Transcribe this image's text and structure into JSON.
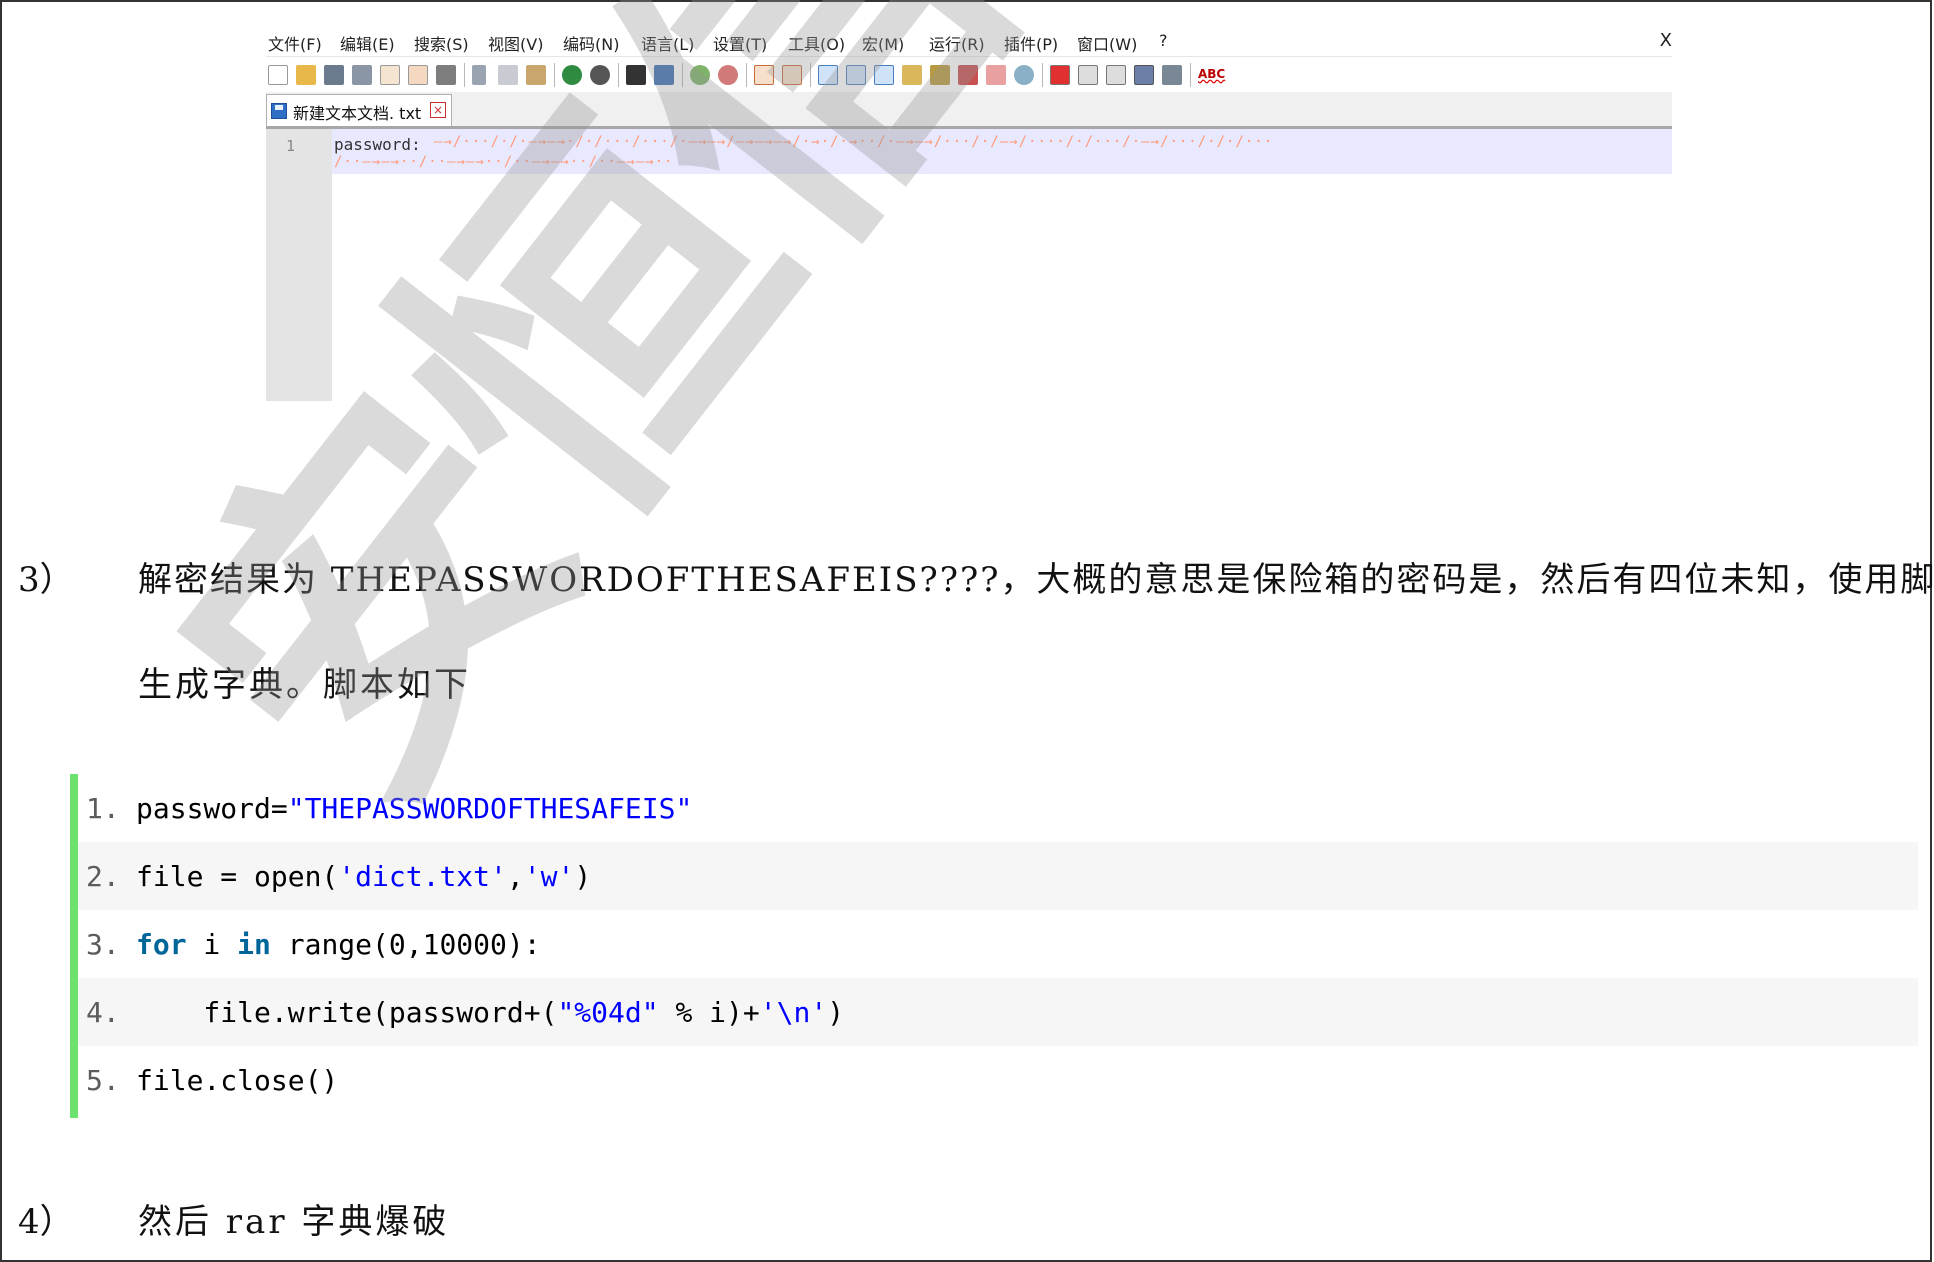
{
  "npp": {
    "menus": [
      "文件(F)",
      "编辑(E)",
      "搜索(S)",
      "视图(V)",
      "编码(N)",
      "语言(L)",
      "设置(T)",
      "工具(O)",
      "宏(M)",
      "运行(R)",
      "插件(P)",
      "窗口(W)",
      "?"
    ],
    "close_label": "X",
    "toolbar_abc": "ABC",
    "tab_label": "新建文本文档. txt",
    "tab_close": "×",
    "line_number": "1",
    "line_text": "password:"
  },
  "doc": {
    "step3_num": "3）",
    "step3_line1": "解密结果为 THEPASSWORDOFTHESAFEIS????，大概的意思是保险箱的密码是，然后有四位未知，使用脚本",
    "step3_line2": "生成字典。脚本如下",
    "step4_num": "4）",
    "step4_text": "然后 rar 字典爆破"
  },
  "code": {
    "lines": [
      {
        "num": "1.",
        "parts": [
          {
            "t": "password=",
            "c": ""
          },
          {
            "t": "\"THEPASSWORDOFTHESAFEIS\"",
            "c": "str"
          }
        ]
      },
      {
        "num": "2.",
        "parts": [
          {
            "t": "file = open(",
            "c": ""
          },
          {
            "t": "'dict.txt'",
            "c": "str"
          },
          {
            "t": ",",
            "c": ""
          },
          {
            "t": "'w'",
            "c": "str"
          },
          {
            "t": ")",
            "c": ""
          }
        ]
      },
      {
        "num": "3.",
        "parts": [
          {
            "t": "for",
            "c": "kw"
          },
          {
            "t": " i ",
            "c": ""
          },
          {
            "t": "in",
            "c": "kw"
          },
          {
            "t": " range(0,10000):",
            "c": ""
          }
        ]
      },
      {
        "num": "4.",
        "parts": [
          {
            "t": "    file.write(password+(",
            "c": ""
          },
          {
            "t": "\"%04d\"",
            "c": "str"
          },
          {
            "t": " % i)+",
            "c": ""
          },
          {
            "t": "'\\n'",
            "c": "str"
          },
          {
            "t": ")",
            "c": ""
          }
        ]
      },
      {
        "num": "5.",
        "parts": [
          {
            "t": "file.close()",
            "c": ""
          }
        ]
      }
    ]
  },
  "watermark": "安恒信息"
}
